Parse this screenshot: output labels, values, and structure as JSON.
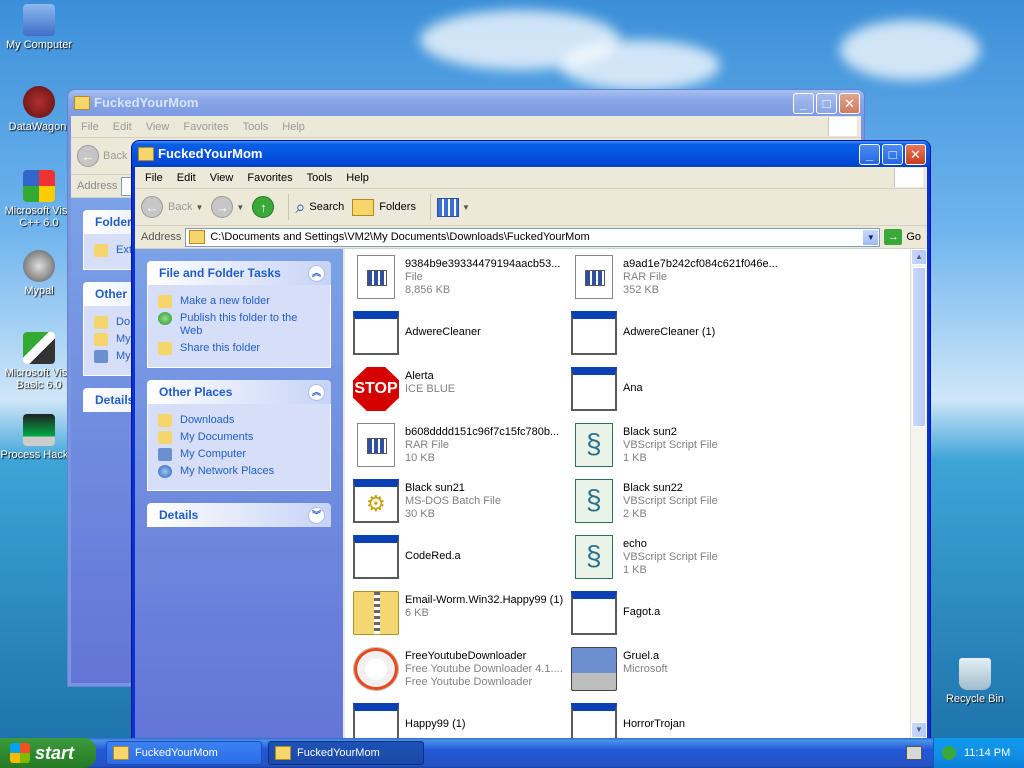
{
  "desktop": {
    "icons": [
      {
        "label": "My Computer",
        "icon": "computer-icon"
      },
      {
        "label": "DataWagon.",
        "icon": "datawagon-icon"
      },
      {
        "label": "Microsoft Visu C++ 6.0",
        "icon": "vcpp-icon"
      },
      {
        "label": "Mypal",
        "icon": "mypal-icon"
      },
      {
        "label": "Microsoft Visu Basic 6.0",
        "icon": "vb-icon"
      },
      {
        "label": "Process Hack 2",
        "icon": "process-hacker-icon"
      },
      {
        "label": "Recycle Bin",
        "icon": "recycle-bin-icon"
      }
    ]
  },
  "back_window": {
    "title": "FuckedYourMom",
    "menu": [
      "File",
      "Edit",
      "View",
      "Favorites",
      "Tools",
      "Help"
    ],
    "back_label": "Back",
    "address_label": "Address",
    "panes": [
      {
        "title": "Folder",
        "items": [
          "Ext"
        ]
      },
      {
        "title": "Other",
        "items": [
          "Do",
          "My",
          "My"
        ]
      },
      {
        "title": "Details",
        "items": []
      }
    ]
  },
  "front_window": {
    "title": "FuckedYourMom",
    "menu": [
      "File",
      "Edit",
      "View",
      "Favorites",
      "Tools",
      "Help"
    ],
    "toolbar": {
      "back": "Back",
      "search": "Search",
      "folders": "Folders"
    },
    "address_label": "Address",
    "address_value": "C:\\Documents and Settings\\VM2\\My Documents\\Downloads\\FuckedYourMom",
    "go_label": "Go",
    "tasks": {
      "title": "File and Folder Tasks",
      "items": [
        "Make a new folder",
        "Publish this folder to the Web",
        "Share this folder"
      ]
    },
    "other_places": {
      "title": "Other Places",
      "items": [
        "Downloads",
        "My Documents",
        "My Computer",
        "My Network Places"
      ]
    },
    "details": {
      "title": "Details"
    },
    "files": [
      {
        "name": "9384b9e39334479194aacb53...",
        "line2": "File",
        "line3": "8,856 KB",
        "icon": "rar-icon"
      },
      {
        "name": "a9ad1e7b242cf084c621f046e...",
        "line2": "RAR File",
        "line3": "352 KB",
        "icon": "rar-icon"
      },
      {
        "name": "AdwereCleaner",
        "line2": "",
        "line3": "",
        "icon": "window-app-icon"
      },
      {
        "name": "AdwereCleaner (1)",
        "line2": "",
        "line3": "",
        "icon": "window-app-icon"
      },
      {
        "name": "Alerta",
        "line2": "ICE BLUE",
        "line3": "",
        "icon": "stop-icon"
      },
      {
        "name": "Ana",
        "line2": "",
        "line3": "",
        "icon": "window-app-icon"
      },
      {
        "name": "b608dddd151c96f7c15fc780b...",
        "line2": "RAR File",
        "line3": "10 KB",
        "icon": "rar-icon"
      },
      {
        "name": "Black sun2",
        "line2": "VBScript Script File",
        "line3": "1 KB",
        "icon": "vbscript-icon"
      },
      {
        "name": "Black sun21",
        "line2": "MS-DOS Batch File",
        "line3": "30 KB",
        "icon": "batch-icon"
      },
      {
        "name": "Black sun22",
        "line2": "VBScript Script File",
        "line3": "2 KB",
        "icon": "vbscript-icon"
      },
      {
        "name": "CodeRed.a",
        "line2": "",
        "line3": "",
        "icon": "window-app-icon"
      },
      {
        "name": "echo",
        "line2": "VBScript Script File",
        "line3": "1 KB",
        "icon": "vbscript-icon"
      },
      {
        "name": "Email-Worm.Win32.Happy99 (1)",
        "line2": "6 KB",
        "line3": "",
        "icon": "zip-icon"
      },
      {
        "name": "Fagot.a",
        "line2": "",
        "line3": "",
        "icon": "window-app-icon"
      },
      {
        "name": "FreeYoutubeDownloader",
        "line2": "Free Youtube Downloader 4.1....",
        "line3": "Free Youtube Downloader",
        "icon": "youtube-downloader-icon"
      },
      {
        "name": "Gruel.a",
        "line2": "Microsoft",
        "line3": "",
        "icon": "computer-app-icon"
      },
      {
        "name": "Happy99 (1)",
        "line2": "",
        "line3": "",
        "icon": "window-app-icon"
      },
      {
        "name": "HorrorTrojan",
        "line2": "",
        "line3": "",
        "icon": "window-app-icon"
      }
    ]
  },
  "taskbar": {
    "start_label": "start",
    "buttons": [
      "FuckedYourMom",
      "FuckedYourMom"
    ],
    "clock": "11:14 PM"
  }
}
